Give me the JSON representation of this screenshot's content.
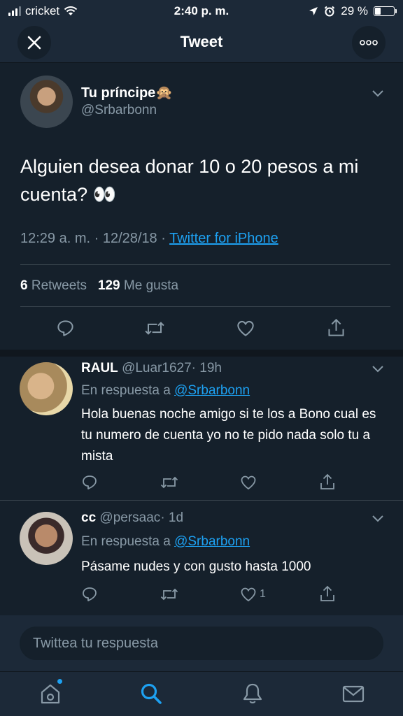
{
  "status_bar": {
    "carrier": "cricket",
    "time": "2:40 p. m.",
    "battery_percent": "29 %",
    "battery_level": 0.29
  },
  "nav": {
    "title": "Tweet",
    "back_icon": "close-icon",
    "more_icon": "more-icon"
  },
  "tweet": {
    "name": "Tu príncipe🙊",
    "handle": "@Srbarbonn",
    "text": "Alguien desea donar 10 o 20 pesos a mi cuenta? 👀",
    "timestamp": "12:29 a. m. · 12/28/18 · ",
    "source": "Twitter for iPhone",
    "retweets_count": "6",
    "retweets_label": "Retweets",
    "likes_count": "129",
    "likes_label": "Me gusta"
  },
  "replies": [
    {
      "name": "RAUL",
      "handle": "@Luar1627",
      "time": "· 19h",
      "reply_to_prefix": "En respuesta a ",
      "reply_to": "@Srbarbonn",
      "text": "Hola buenas noche amigo si te los a Bono cual es tu numero de cuenta yo no te pido nada solo tu a mista",
      "like_count": ""
    },
    {
      "name": "cc",
      "handle": "@persaac",
      "time": "· 1d",
      "reply_to_prefix": "En respuesta a ",
      "reply_to": "@Srbarbonn",
      "text": "Pásame nudes y con gusto hasta 1000",
      "like_count": "1"
    }
  ],
  "composer": {
    "placeholder": "Twittea tu respuesta"
  },
  "tab_bar": {
    "items": [
      "home-icon",
      "search-icon",
      "notifications-icon",
      "messages-icon"
    ]
  },
  "colors": {
    "background": "#15202b",
    "bar": "#1c2938",
    "accent": "#1da1f2",
    "muted": "#8899a6"
  }
}
